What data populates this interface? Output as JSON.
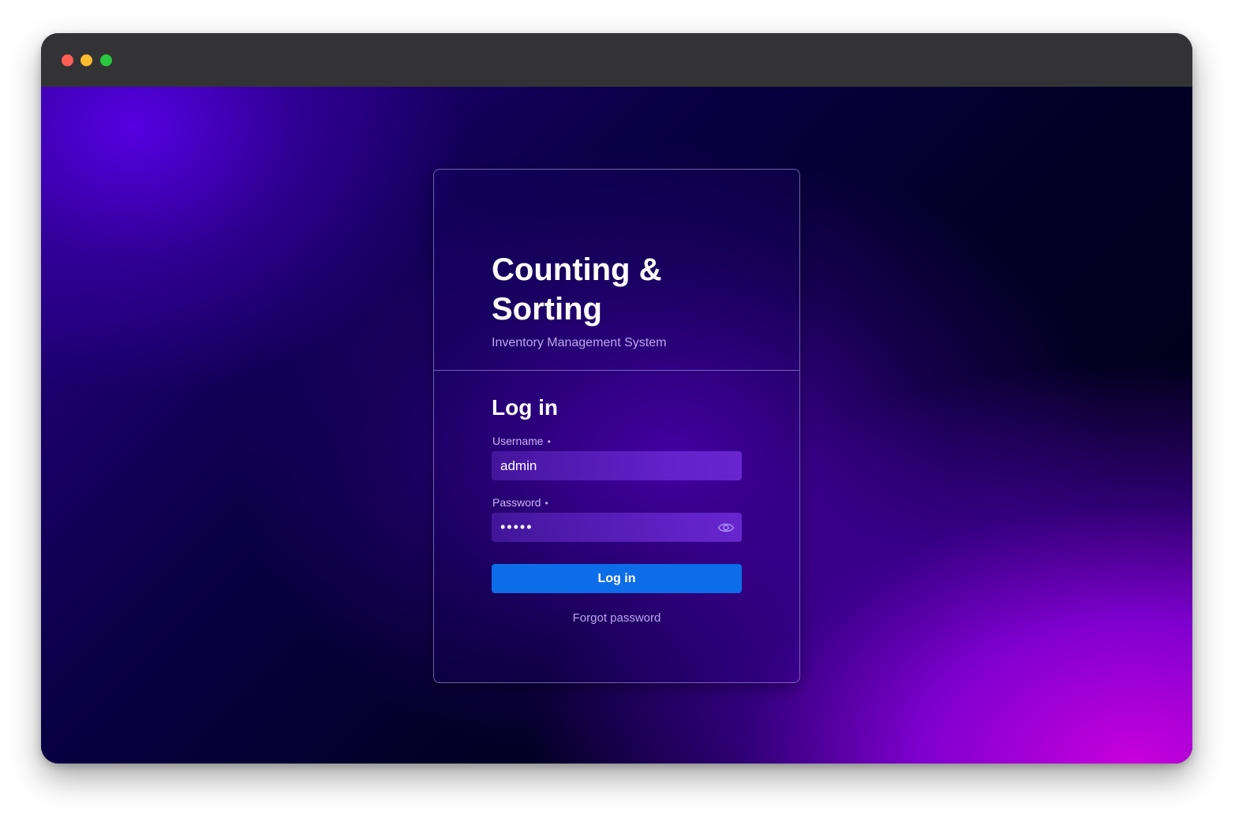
{
  "app": {
    "title": "Counting & Sorting",
    "subtitle": "Inventory Management System"
  },
  "login": {
    "heading": "Log in",
    "username_label": "Username",
    "username_value": "admin",
    "password_label": "Password",
    "password_value": "•••••",
    "required_marker": "•",
    "submit_label": "Log in",
    "forgot_label": "Forgot password"
  },
  "icons": {
    "password_toggle": "eye-icon"
  },
  "colors": {
    "primary_button": "#0d6de8",
    "label_text": "#c7b8f5",
    "window_close": "#ff5f57",
    "window_minimize": "#febc2e",
    "window_maximize": "#28c840"
  }
}
